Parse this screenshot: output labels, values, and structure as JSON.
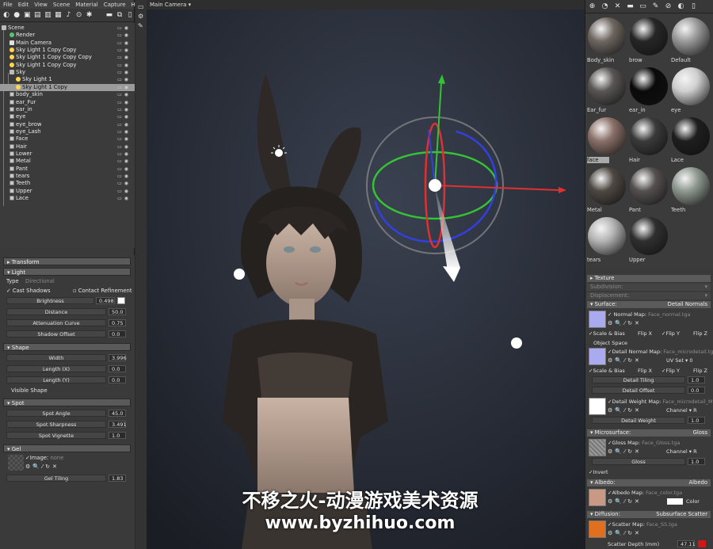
{
  "menu": [
    "File",
    "Edit",
    "View",
    "Scene",
    "Material",
    "Capture",
    "Help"
  ],
  "viewport": {
    "camera_label": "Main Camera ▾"
  },
  "scene_tree": [
    {
      "label": "Scene",
      "icon": "scene-icon"
    },
    {
      "label": "Render",
      "icon": "render-icon"
    },
    {
      "label": "Main Camera",
      "icon": "camera-icon"
    },
    {
      "label": "Sky Light 1 Copy Copy",
      "icon": "light-icon"
    },
    {
      "label": "Sky Light 1 Copy Copy Copy",
      "icon": "light-icon"
    },
    {
      "label": "Sky Light 1 Copy Copy",
      "icon": "light-icon"
    },
    {
      "label": "Sky",
      "icon": "folder-icon"
    },
    {
      "label": "Sky Light 1",
      "icon": "light-icon"
    },
    {
      "label": "Sky Light 1 Copy",
      "icon": "light-icon",
      "selected": true
    },
    {
      "label": "body_skin",
      "icon": "mesh-icon"
    },
    {
      "label": "ear_Fur",
      "icon": "mesh-icon"
    },
    {
      "label": "ear_in",
      "icon": "mesh-icon"
    },
    {
      "label": "eye",
      "icon": "mesh-icon"
    },
    {
      "label": "eye_brow",
      "icon": "mesh-icon"
    },
    {
      "label": "eye_Lash",
      "icon": "mesh-icon"
    },
    {
      "label": "Face",
      "icon": "mesh-icon"
    },
    {
      "label": "Hair",
      "icon": "mesh-icon"
    },
    {
      "label": "Lower",
      "icon": "mesh-icon"
    },
    {
      "label": "Metal",
      "icon": "mesh-icon"
    },
    {
      "label": "Pant",
      "icon": "mesh-icon"
    },
    {
      "label": "tears",
      "icon": "mesh-icon"
    },
    {
      "label": "Teeth",
      "icon": "mesh-icon"
    },
    {
      "label": "Upper",
      "icon": "mesh-icon"
    },
    {
      "label": "Lace",
      "icon": "mesh-icon"
    }
  ],
  "left_props": {
    "transform": "Transform",
    "light": "Light",
    "type_label": "Type",
    "type_value": "Directional",
    "cast_shadows": "Cast Shadows",
    "contact_refinement": "Contact Refinement",
    "brightness_label": "Brightness",
    "brightness_value": "0.498",
    "distance_label": "Distance",
    "distance_value": "50.0",
    "attenuation_label": "Attenuation Curve",
    "attenuation_value": "0.75",
    "shadow_offset_label": "Shadow Offset",
    "shadow_offset_value": "0.0",
    "shape": "Shape",
    "width_label": "Width",
    "width_value": "3.996",
    "lengthx_label": "Length (X)",
    "lengthx_value": "0.0",
    "lengthy_label": "Length (Y)",
    "lengthy_value": "0.0",
    "visible_shape": "Visible Shape",
    "spot": "Spot",
    "spot_angle_label": "Spot Angle",
    "spot_angle_value": "45.0",
    "spot_sharpness_label": "Spot Sharpness",
    "spot_sharpness_value": "3.491",
    "spot_vignette_label": "Spot Vignette",
    "spot_vignette_value": "1.0",
    "gel": "Gel",
    "image_label": "Image:",
    "image_value": "none",
    "gel_tiling_label": "Gel Tiling",
    "gel_tiling_value": "1.83"
  },
  "materials": [
    {
      "name": "Body_skin",
      "color": "#6e6660",
      "selected": false
    },
    {
      "name": "brow",
      "color": "#262626",
      "selected": false
    },
    {
      "name": "Default",
      "color": "#9a9a9a",
      "selected": false
    },
    {
      "name": "Ear_fur",
      "color": "#5a5555",
      "selected": false
    },
    {
      "name": "ear_in",
      "color": "#0a0a0a",
      "selected": false
    },
    {
      "name": "eye",
      "color": "#cfcfcf",
      "selected": false
    },
    {
      "name": "face",
      "color": "#8a7068",
      "selected": true
    },
    {
      "name": "Hair",
      "color": "#3a3a3a",
      "selected": false
    },
    {
      "name": "Lace",
      "color": "#1e1e1e",
      "selected": false
    },
    {
      "name": "Metal",
      "color": "#4e4842",
      "selected": false
    },
    {
      "name": "Pant",
      "color": "#555050",
      "selected": false
    },
    {
      "name": "Teeth",
      "color": "#8f9990",
      "selected": false
    },
    {
      "name": "tears",
      "color": "#b5b5b5",
      "selected": false
    },
    {
      "name": "Upper",
      "color": "#2f2f2f",
      "selected": false
    }
  ],
  "right_props": {
    "texture": "Texture",
    "subdivision": "Subdivision:",
    "displacement": "Displacement:",
    "surface": "Surface:",
    "surface_type": "Detail Normals",
    "normal_map_label": "Normal Map:",
    "normal_map_file": "Face_normal.tga",
    "scale_bias": "Scale & Bias",
    "flip_x": "Flip X",
    "flip_y": "Flip Y",
    "flip_z": "Flip Z",
    "object_space": "Object Space",
    "detail_normal_label": "Detail Normal Map:",
    "detail_normal_file": "Face_microdetail.tga",
    "uv_set": "UV Set ▾ 0",
    "detail_tiling_label": "Detail Tiling",
    "detail_tiling_value": "1.0",
    "detail_offset_label": "Detail Offset",
    "detail_offset_value": "0.0",
    "detail_weight_map_label": "Detail Weight Map:",
    "detail_weight_map_file": "Face_microdetail_M",
    "channel_r": "Channel ▾ R",
    "detail_weight_label": "Detail Weight",
    "detail_weight_value": "1.0",
    "microsurface": "Microsurface:",
    "microsurface_type": "Gloss",
    "gloss_map_label": "Gloss Map:",
    "gloss_map_file": "Face_Gloss.tga",
    "gloss_label": "Gloss",
    "gloss_value": "1.0",
    "invert": "Invert",
    "albedo": "Albedo:",
    "albedo_type": "Albedo",
    "albedo_map_label": "Albedo Map:",
    "albedo_map_file": "Face_color.tga",
    "color_label": "Color",
    "diffusion": "Diffusion:",
    "diffusion_type": "Subsurface Scatter",
    "scatter_map_label": "Scatter Map:",
    "scatter_map_file": "Face_SS.tga",
    "scatter_depth_label": "Scatter Depth (mm)",
    "scatter_depth_value": "47.11"
  },
  "watermark": {
    "line1": "不移之火-动漫游戏美术资源",
    "line2": "www.byzhihuo.com"
  },
  "colors": {
    "normal_map_thumb": "#aaaaee",
    "scatter_color": "#d01818",
    "albedo_color": "#ffffff",
    "selection": "#9a9a9a",
    "axis_x": "#e03030",
    "axis_y": "#35c335",
    "axis_z": "#3340e0"
  }
}
